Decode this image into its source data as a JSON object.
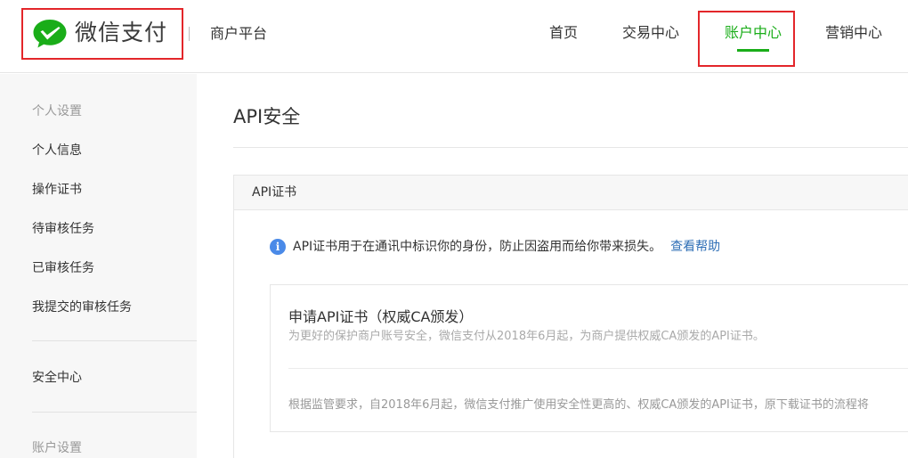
{
  "header": {
    "logo_text": "微信支付",
    "platform": "商户平台",
    "nav": {
      "home": "首页",
      "transactions": "交易中心",
      "account": "账户中心",
      "marketing": "营销中心"
    }
  },
  "sidebar": {
    "group_personal": "个人设置",
    "items_personal": [
      "个人信息",
      "操作证书",
      "待审核任务",
      "已审核任务",
      "我提交的审核任务"
    ],
    "security": "安全中心",
    "group_account": "账户设置"
  },
  "main": {
    "page_title": "API安全",
    "panel_title": "API证书",
    "info_text": "API证书用于在通讯中标识你的身份，防止因盗用而给你带来损失。",
    "help_link": "查看帮助",
    "card": {
      "title": "申请API证书（权威CA颁发）",
      "subtitle": "为更好的保护商户账号安全，微信支付从2018年6月起，为商户提供权威CA颁发的API证书。",
      "body": "根据监管要求，自2018年6月起，微信支付推广使用安全性更高的、权威CA颁发的API证书，原下载证书的流程将"
    }
  },
  "colors": {
    "brand_green": "#1aad19",
    "highlight_red": "#e3262a",
    "link_blue": "#2f6fb6",
    "info_blue": "#4a8ae8"
  }
}
